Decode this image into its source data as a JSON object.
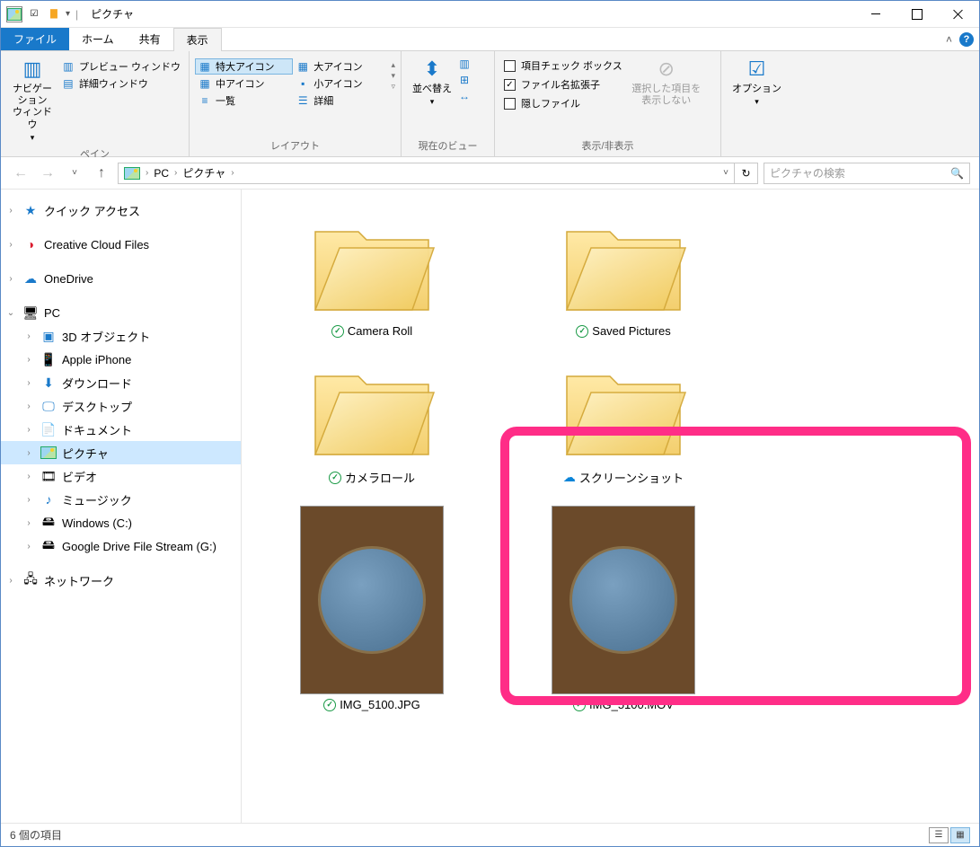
{
  "titlebar": {
    "title": "ピクチャ"
  },
  "tabs": {
    "file": "ファイル",
    "home": "ホーム",
    "share": "共有",
    "view": "表示"
  },
  "ribbon": {
    "panes_group": "ペイン",
    "nav_pane": "ナビゲーション\nウィンドウ",
    "preview_pane": "プレビュー ウィンドウ",
    "detail_pane": "詳細ウィンドウ",
    "layout_group": "レイアウト",
    "xl_icons": "特大アイコン",
    "l_icons": "大アイコン",
    "m_icons": "中アイコン",
    "s_icons": "小アイコン",
    "list": "一覧",
    "details": "詳細",
    "ext_dropdown_hint": "▾",
    "currentview_group": "現在のビュー",
    "sort": "並べ替え",
    "showhide_group": "表示/非表示",
    "item_checkboxes": "項目チェック ボックス",
    "file_ext": "ファイル名拡張子",
    "hidden_items": "隠しファイル",
    "hide_selected": "選択した項目を\n表示しない",
    "options": "オプション"
  },
  "address": {
    "pc": "PC",
    "pictures": "ピクチャ",
    "search_placeholder": "ピクチャの検索"
  },
  "sidebar": {
    "quick_access": "クイック アクセス",
    "creative_cloud": "Creative Cloud Files",
    "onedrive": "OneDrive",
    "pc": "PC",
    "objects3d": "3D オブジェクト",
    "apple": "Apple iPhone",
    "downloads": "ダウンロード",
    "desktop": "デスクトップ",
    "documents": "ドキュメント",
    "pictures": "ピクチャ",
    "videos": "ビデオ",
    "music": "ミュージック",
    "cdrive": "Windows (C:)",
    "gdrive": "Google Drive File Stream (G:)",
    "network": "ネットワーク"
  },
  "items": {
    "folder1": "Camera Roll",
    "folder2": "Saved Pictures",
    "folder3": "カメラロール",
    "folder4": "スクリーンショット",
    "file1": "IMG_5100.JPG",
    "file2": "IMG_5100.MOV"
  },
  "status": {
    "count_label": "6 個の項目"
  }
}
